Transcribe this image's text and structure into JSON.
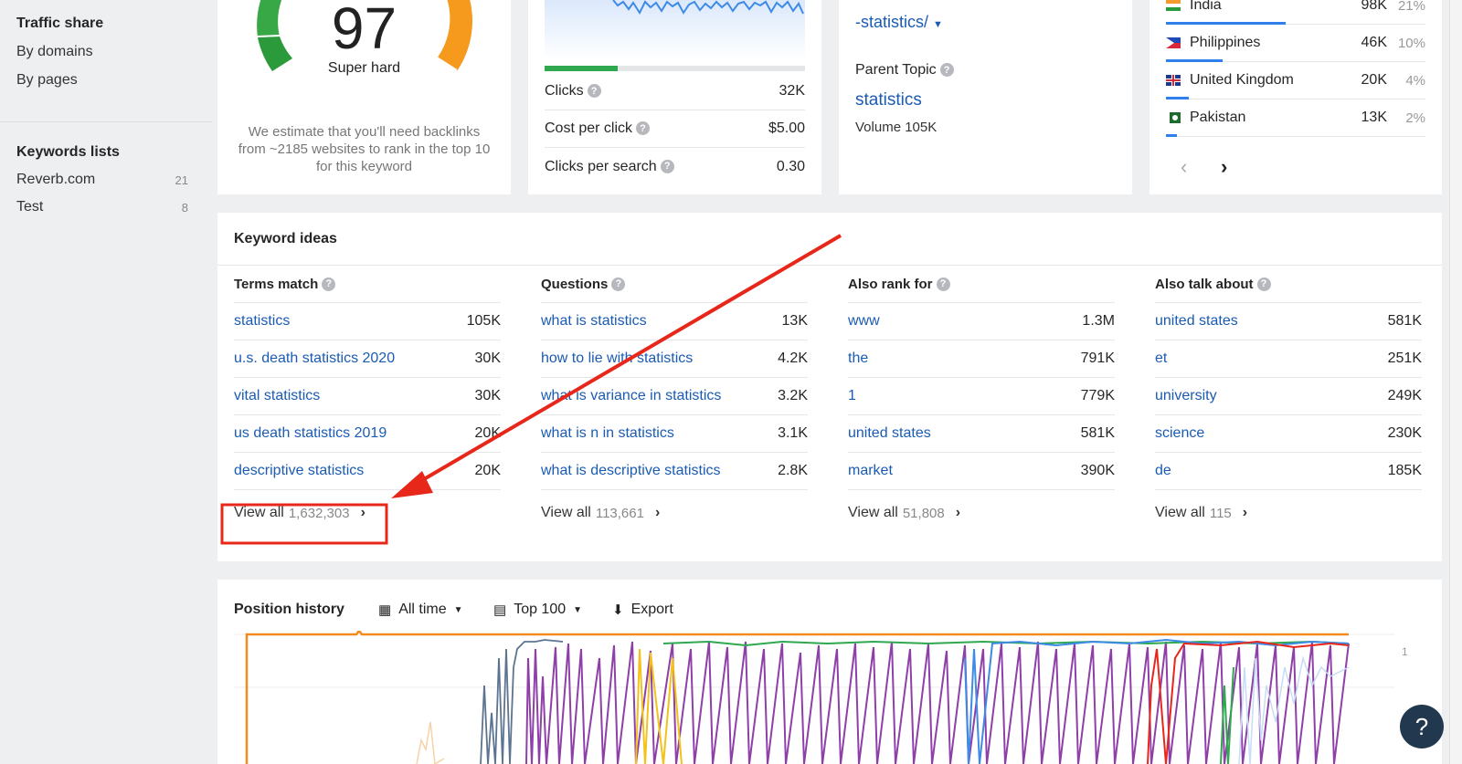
{
  "sidebar": {
    "traffic_share": "Traffic share",
    "by_domains": "By domains",
    "by_pages": "By pages",
    "keywords_lists": "Keywords lists",
    "lists": [
      {
        "name": "Reverb.com",
        "count": "21"
      },
      {
        "name": "Test",
        "count": "8"
      }
    ]
  },
  "kd": {
    "score": "97",
    "label": "Super hard",
    "description": "We estimate that you'll need backlinks from ~2185 websites to rank in the top 10 for this keyword"
  },
  "metrics": {
    "clicks_label": "Clicks",
    "clicks_value": "32K",
    "cpc_label": "Cost per click",
    "cpc_value": "$5.00",
    "cps_label": "Clicks per search",
    "cps_value": "0.30"
  },
  "parent": {
    "url_fragment": "-statistics/",
    "label": "Parent Topic",
    "topic": "statistics",
    "volume": "Volume 105K"
  },
  "countries": [
    {
      "name": "India",
      "value": "98K",
      "pct": "21%",
      "share": 0.21
    },
    {
      "name": "Philippines",
      "value": "46K",
      "pct": "10%",
      "share": 0.1
    },
    {
      "name": "United Kingdom",
      "value": "20K",
      "pct": "4%",
      "share": 0.04
    },
    {
      "name": "Pakistan",
      "value": "13K",
      "pct": "2%",
      "share": 0.02
    }
  ],
  "keyword_ideas": {
    "title": "Keyword ideas",
    "view_all": "View all",
    "columns": [
      {
        "header": "Terms match",
        "count": "1,632,303",
        "rows": [
          {
            "kw": "statistics",
            "vol": "105K"
          },
          {
            "kw": "u.s. death statistics 2020",
            "vol": "30K"
          },
          {
            "kw": "vital statistics",
            "vol": "30K"
          },
          {
            "kw": "us death statistics 2019",
            "vol": "20K"
          },
          {
            "kw": "descriptive statistics",
            "vol": "20K"
          }
        ]
      },
      {
        "header": "Questions",
        "count": "113,661",
        "rows": [
          {
            "kw": "what is statistics",
            "vol": "13K"
          },
          {
            "kw": "how to lie with statistics",
            "vol": "4.2K"
          },
          {
            "kw": "what is variance in statistics",
            "vol": "3.2K"
          },
          {
            "kw": "what is n in statistics",
            "vol": "3.1K"
          },
          {
            "kw": "what is descriptive statistics",
            "vol": "2.8K"
          }
        ]
      },
      {
        "header": "Also rank for",
        "count": "51,808",
        "rows": [
          {
            "kw": "www",
            "vol": "1.3M"
          },
          {
            "kw": "the",
            "vol": "791K"
          },
          {
            "kw": "1",
            "vol": "779K"
          },
          {
            "kw": "united states",
            "vol": "581K"
          },
          {
            "kw": "market",
            "vol": "390K"
          }
        ]
      },
      {
        "header": "Also talk about",
        "count": "115",
        "rows": [
          {
            "kw": "united states",
            "vol": "581K"
          },
          {
            "kw": "et",
            "vol": "251K"
          },
          {
            "kw": "university",
            "vol": "249K"
          },
          {
            "kw": "science",
            "vol": "230K"
          },
          {
            "kw": "de",
            "vol": "185K"
          }
        ]
      }
    ]
  },
  "position_history": {
    "title": "Position history",
    "range": "All time",
    "top": "Top 100",
    "export": "Export",
    "axis_label": "1"
  },
  "help": "?",
  "colors": {
    "link": "#1a5bb4",
    "annotation": "#e8271b",
    "accent": "#2f80ed"
  }
}
